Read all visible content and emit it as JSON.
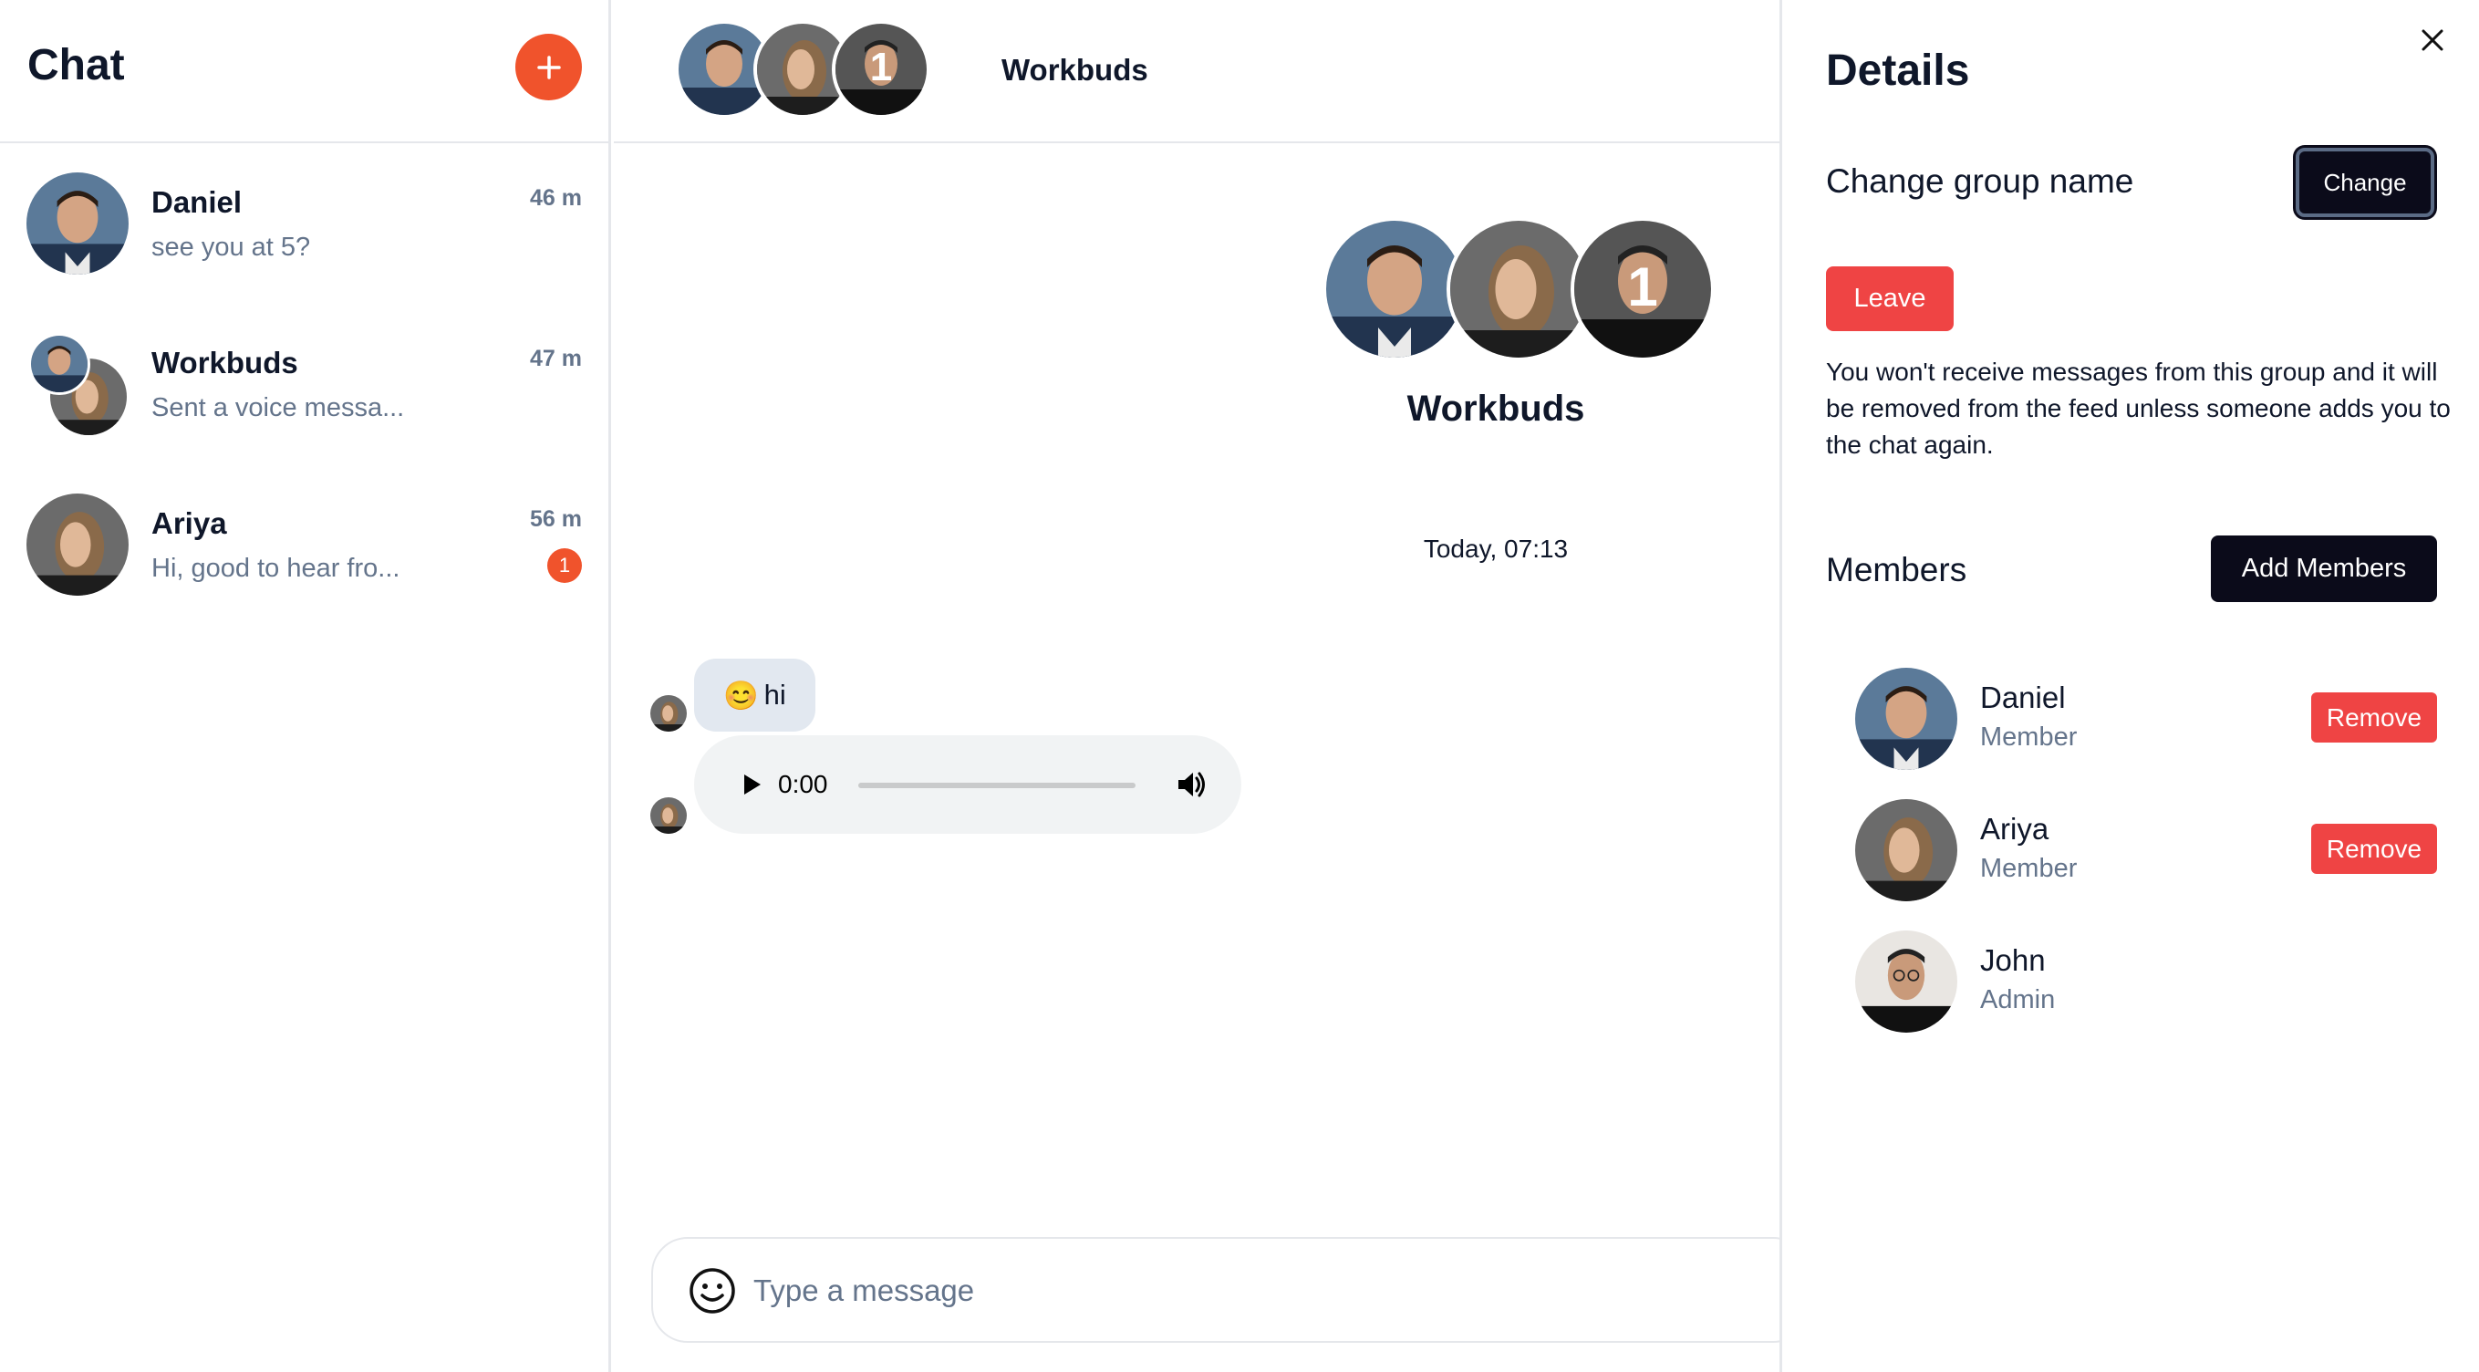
{
  "sidebar": {
    "title": "Chat",
    "chats": [
      {
        "name": "Daniel",
        "preview": "see you at 5?",
        "time": "46 m"
      },
      {
        "name": "Workbuds",
        "preview": "Sent a voice messa...",
        "time": "47 m"
      },
      {
        "name": "Ariya",
        "preview": "Hi, good to hear fro...",
        "time": "56 m",
        "unread": "1"
      }
    ]
  },
  "main": {
    "header_title": "Workbuds",
    "group_name": "Workbuds",
    "date_divider": "Today, 07:13",
    "messages": [
      {
        "emoji": "😊",
        "text": "hi"
      }
    ],
    "audio": {
      "time": "0:00",
      "progress": 0
    },
    "composer_placeholder": "Type a message"
  },
  "details": {
    "title": "Details",
    "change_group_label": "Change group name",
    "change_button": "Change",
    "leave_button": "Leave",
    "leave_note": "You won't receive messages from this group and it will be removed from the feed unless someone adds you to the chat again.",
    "members_label": "Members",
    "add_members_button": "Add Members",
    "members": [
      {
        "name": "Daniel",
        "role": "Member",
        "remove": "Remove"
      },
      {
        "name": "Ariya",
        "role": "Member",
        "remove": "Remove"
      },
      {
        "name": "John",
        "role": "Admin"
      }
    ]
  },
  "colors": {
    "accent": "#f0532c",
    "danger": "#ef4444",
    "dark_button": "#0b0b1a",
    "muted_text": "#64748b"
  }
}
